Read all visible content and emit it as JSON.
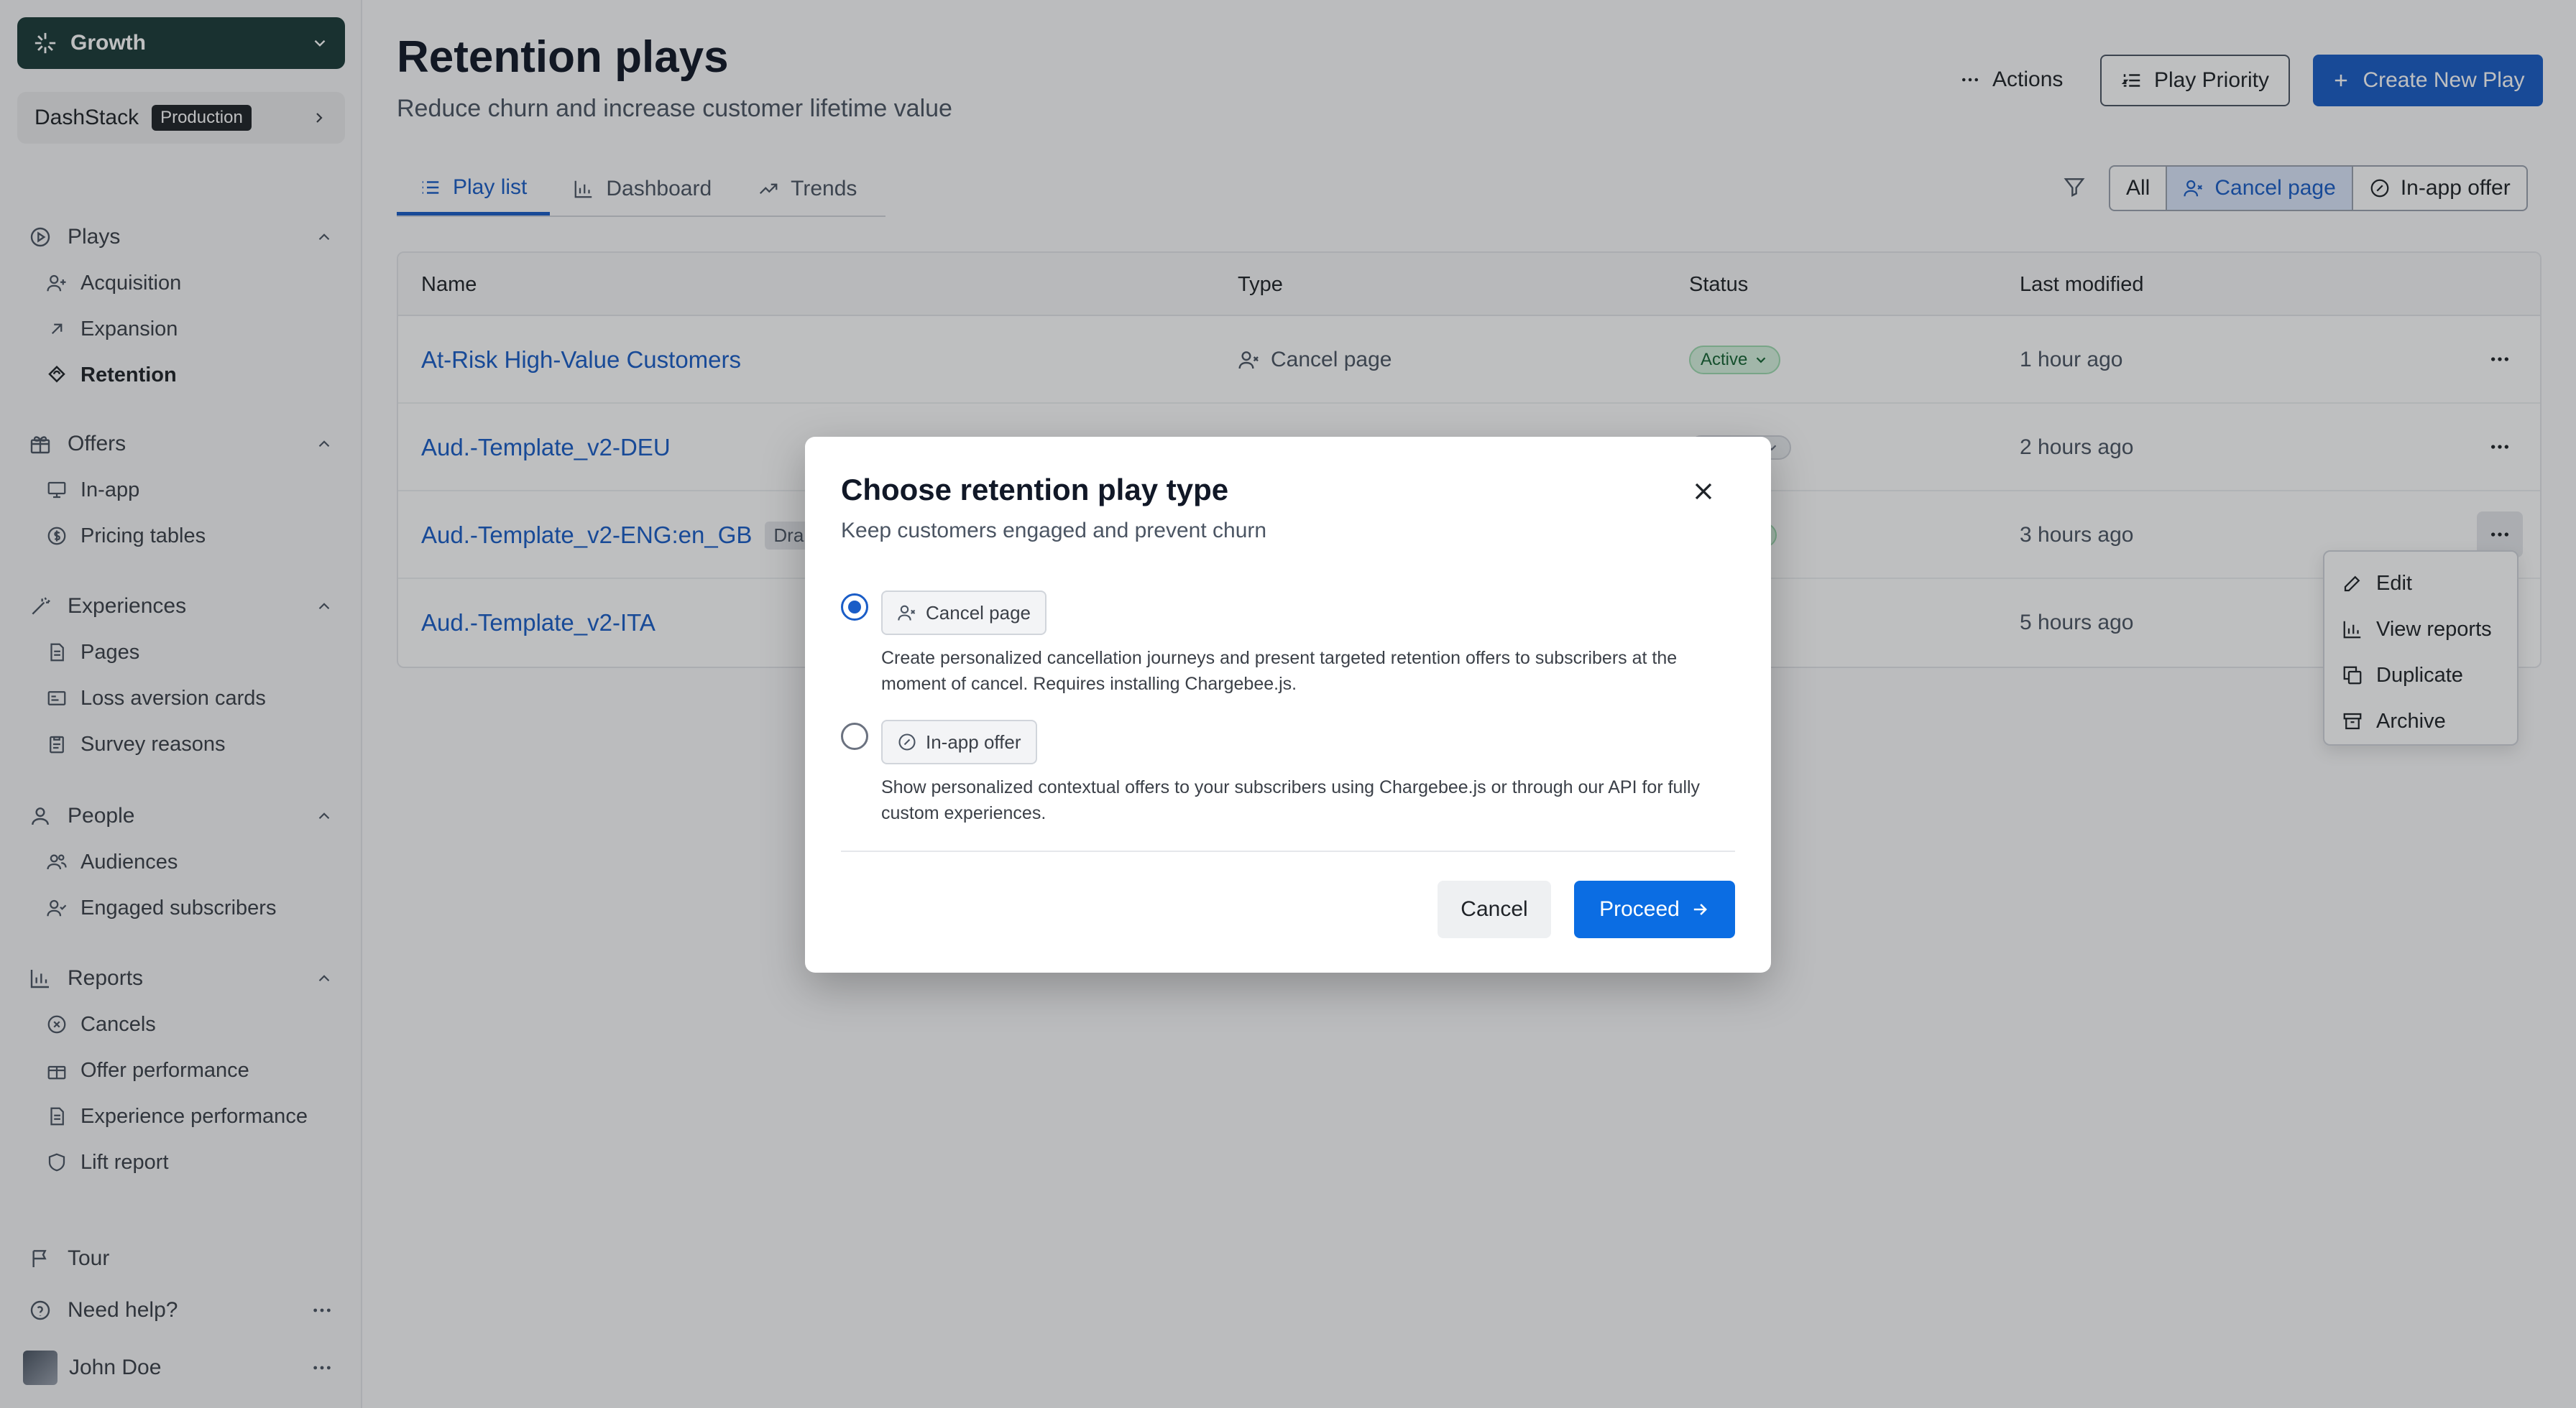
{
  "workspace": {
    "name": "Growth"
  },
  "site": {
    "name": "DashStack",
    "env_badge": "Production"
  },
  "sidebar": {
    "sections": [
      {
        "label": "Plays",
        "items": [
          "Acquisition",
          "Expansion",
          "Retention"
        ]
      },
      {
        "label": "Offers",
        "items": [
          "In-app",
          "Pricing tables"
        ]
      },
      {
        "label": "Experiences",
        "items": [
          "Pages",
          "Loss aversion cards",
          "Survey reasons"
        ]
      },
      {
        "label": "People",
        "items": [
          "Audiences",
          "Engaged subscribers"
        ]
      },
      {
        "label": "Reports",
        "items": [
          "Cancels",
          "Offer performance",
          "Experience performance",
          "Lift report"
        ]
      }
    ],
    "active_item": "Retention",
    "bottom": {
      "tour": "Tour",
      "help": "Need help?",
      "user": "John Doe"
    }
  },
  "page": {
    "title": "Retention plays",
    "subtitle": "Reduce churn and increase customer lifetime value",
    "actions_label": "Actions",
    "priority_label": "Play Priority",
    "create_label": "Create New Play"
  },
  "tabs": [
    {
      "label": "Play list",
      "active": true
    },
    {
      "label": "Dashboard",
      "active": false
    },
    {
      "label": "Trends",
      "active": false
    }
  ],
  "filters": {
    "options": [
      "All",
      "Cancel page",
      "In-app offer"
    ],
    "selected": "Cancel page"
  },
  "table": {
    "columns": [
      "Name",
      "Type",
      "Status",
      "Last modified"
    ],
    "rows": [
      {
        "name": "At-Risk High-Value Customers",
        "type": "Cancel page",
        "status": "Active",
        "modified": "1 hour ago"
      },
      {
        "name": "Aud.-Template_v2-DEU",
        "type": "",
        "status": "",
        "modified": "2 hours ago"
      },
      {
        "name": "Aud.-Template_v2-ENG:en_GB",
        "tag": "Dra",
        "type": "",
        "status": "",
        "modified": "3 hours ago"
      },
      {
        "name": "Aud.-Template_v2-ITA",
        "type": "",
        "status": "",
        "modified": "5 hours ago"
      }
    ]
  },
  "context_menu": {
    "items": [
      "Edit",
      "View reports",
      "Duplicate",
      "Archive"
    ]
  },
  "modal": {
    "title": "Choose retention play type",
    "subtitle": "Keep customers engaged and prevent churn",
    "options": [
      {
        "label": "Cancel page",
        "selected": true,
        "description": "Create personalized cancellation journeys and present targeted retention offers to subscribers at the moment of cancel. Requires installing Chargebee.js."
      },
      {
        "label": "In-app offer",
        "selected": false,
        "description": "Show personalized contextual offers to your subscribers using Chargebee.js or through our API for fully custom experiences."
      }
    ],
    "cancel_label": "Cancel",
    "proceed_label": "Proceed"
  },
  "colors": {
    "primary": "#1a5dc7",
    "proceed": "#0b6de3",
    "workspace_bg": "#1b3b38",
    "active_status": "#d7f3df"
  }
}
